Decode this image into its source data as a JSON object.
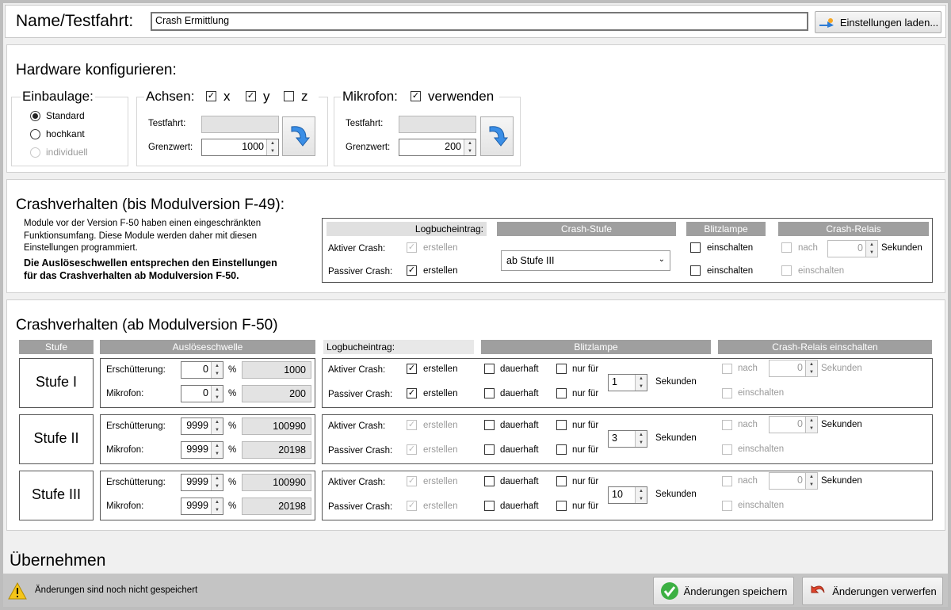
{
  "header": {
    "name_label": "Name/Testfahrt:",
    "name_value": "Crash Ermittlung",
    "load_button": "Einstellungen laden..."
  },
  "hardware": {
    "title": "Hardware konfigurieren:",
    "einbaulage": {
      "label": "Einbaulage:",
      "options": [
        "Standard",
        "hochkant",
        "individuell"
      ],
      "selected": "Standard"
    },
    "achsen": {
      "label": "Achsen:",
      "x": "x",
      "y": "y",
      "z": "z",
      "x_checked": true,
      "y_checked": true,
      "z_checked": false,
      "testfahrt_label": "Testfahrt:",
      "grenzwert_label": "Grenzwert:",
      "grenzwert": "1000"
    },
    "mikrofon": {
      "label": "Mikrofon:",
      "verwenden": "verwenden",
      "checked": true,
      "testfahrt_label": "Testfahrt:",
      "grenzwert_label": "Grenzwert:",
      "grenzwert": "200"
    }
  },
  "crash_old": {
    "title": "Crashverhalten (bis Modulversion F-49):",
    "info": [
      "Module vor der Version F-50 haben einen eingeschränkten",
      "Funktionsumfang. Diese Module werden daher mit diesen",
      "Einstellungen programmiert."
    ],
    "info_bold": [
      "Die Auslöseschwellen entsprechen den Einstellungen",
      "für das Crashverhalten ab Modulversion F-50."
    ],
    "headers": {
      "log": "Logbucheintrag:",
      "stufe": "Crash-Stufe",
      "blitz": "Blitzlampe",
      "relais": "Crash-Relais"
    },
    "aktiv_label": "Aktiver Crash:",
    "passiv_label": "Passiver Crash:",
    "erstellen": "erstellen",
    "stufe_select": "ab Stufe III",
    "einschalten": "einschalten",
    "nach": "nach",
    "nach_value": "0",
    "sekunden": "Sekunden"
  },
  "crash_new": {
    "title": "Crashverhalten (ab Modulversion F-50)",
    "headers": {
      "stufe": "Stufe",
      "schwelle": "Auslöseschwelle",
      "log": "Logbucheintrag:",
      "blitz": "Blitzlampe",
      "relais": "Crash-Relais einschalten"
    },
    "labels": {
      "erschuetterung": "Erschütterung:",
      "mikrofon": "Mikrofon:",
      "percent": "%",
      "aktiv": "Aktiver Crash:",
      "passiv": "Passiver Crash:",
      "erstellen": "erstellen",
      "dauerhaft": "dauerhaft",
      "nur_fuer": "nur für",
      "sekunden": "Sekunden",
      "nach": "nach",
      "einschalten": "einschalten"
    },
    "stufen": [
      {
        "name": "Stufe I",
        "erschuetterung": "0",
        "erschuetterung_abs": "1000",
        "mikrofon": "0",
        "mikrofon_abs": "200",
        "blitz_sek": "1",
        "relais_nach": "0",
        "enabled": true
      },
      {
        "name": "Stufe II",
        "erschuetterung": "9999",
        "erschuetterung_abs": "100990",
        "mikrofon": "9999",
        "mikrofon_abs": "20198",
        "blitz_sek": "3",
        "relais_nach": "0",
        "enabled": false
      },
      {
        "name": "Stufe III",
        "erschuetterung": "9999",
        "erschuetterung_abs": "100990",
        "mikrofon": "9999",
        "mikrofon_abs": "20198",
        "blitz_sek": "10",
        "relais_nach": "0",
        "enabled": false
      }
    ]
  },
  "apply": {
    "title": "Übernehmen"
  },
  "status": {
    "message": "Änderungen sind noch nicht gespeichert",
    "save": "Änderungen speichern",
    "discard": "Änderungen verwerfen"
  }
}
